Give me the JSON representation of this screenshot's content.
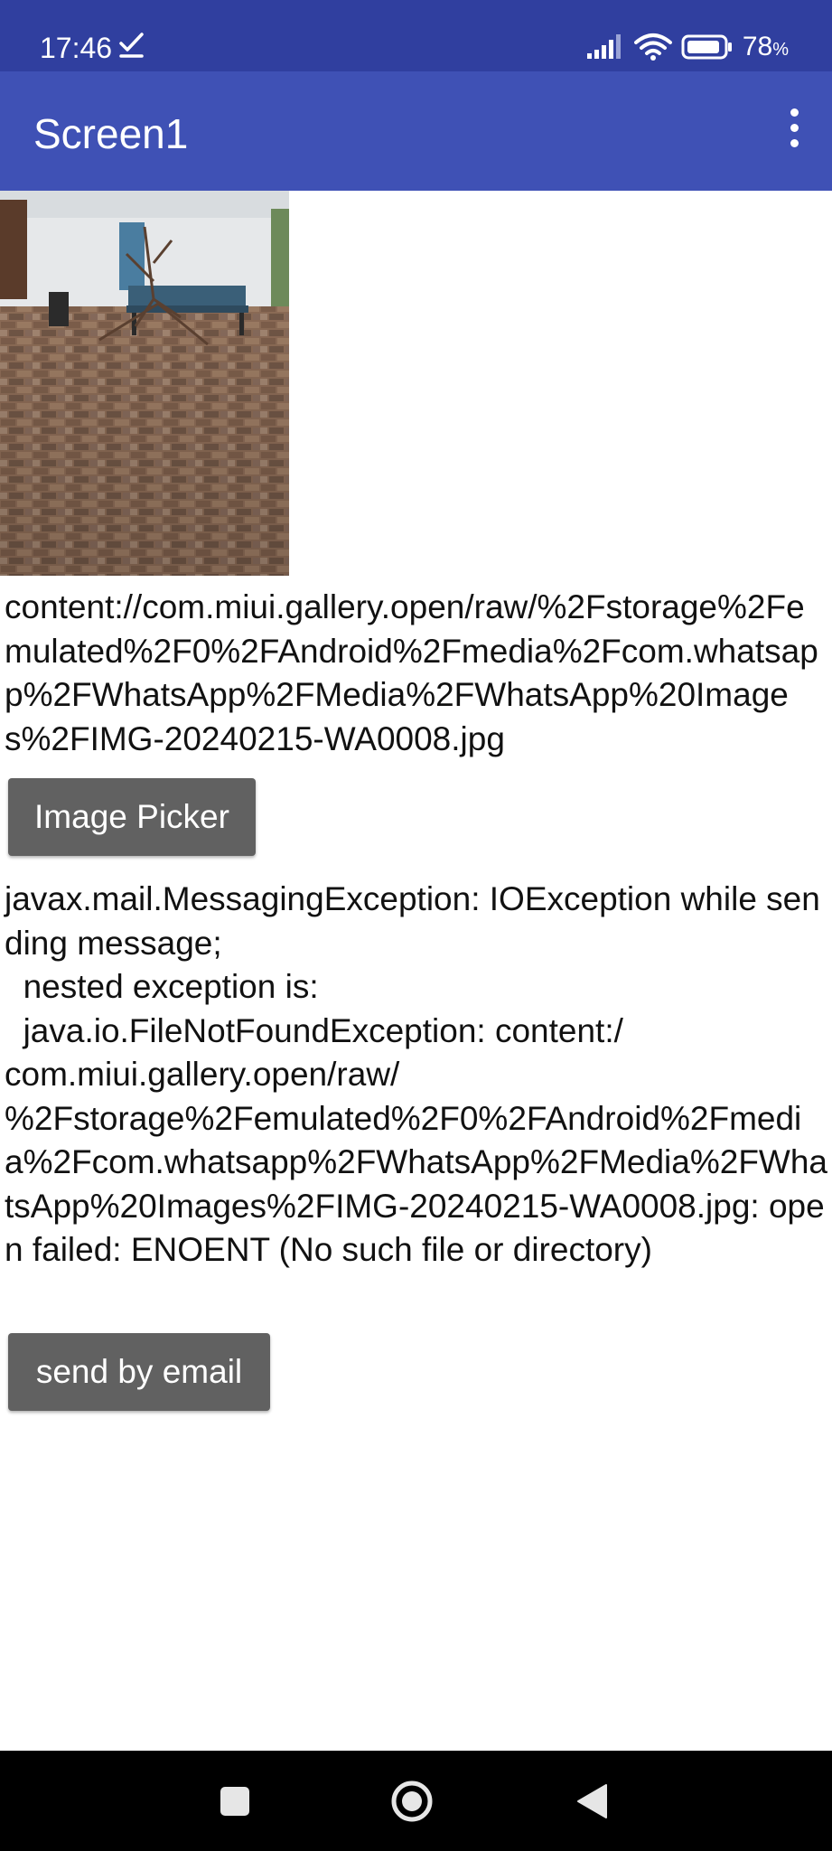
{
  "status_bar": {
    "time": "17:46",
    "battery": "78",
    "battery_unit": "%",
    "icons": [
      "check-icon",
      "signal-icon",
      "wifi-icon",
      "battery-icon"
    ]
  },
  "app_bar": {
    "title": "Screen1",
    "menu_icon": "more-vert-icon"
  },
  "image": {
    "description_icon": "photo"
  },
  "uri_label": "content://com.miui.gallery.open/raw/%2Fstorage%2Femulated%2F0%2FAndroid%2Fmedia%2Fcom.whatsapp%2FWhatsApp%2FMedia%2FWhatsApp%20Images%2FIMG-20240215-WA0008.jpg",
  "buttons": {
    "image_picker": "Image Picker",
    "send_email": "send by email"
  },
  "error_label": "javax.mail.MessagingException: IOException while sending message;\n  nested exception is:\n  java.io.FileNotFoundException: content:/\ncom.miui.gallery.open/raw/\n%2Fstorage%2Femulated%2F0%2FAndroid%2Fmedia%2Fcom.whatsapp%2FWhatsApp%2FMedia%2FWhatsApp%20Images%2FIMG-20240215-WA0008.jpg: open failed: ENOENT (No such file or directory)",
  "nav_bar": {
    "icons": [
      "recents-icon",
      "home-icon",
      "back-icon"
    ]
  },
  "colors": {
    "status_bar": "#303f9f",
    "app_bar": "#3f51b5",
    "button": "#616161",
    "nav_bar": "#000000"
  }
}
